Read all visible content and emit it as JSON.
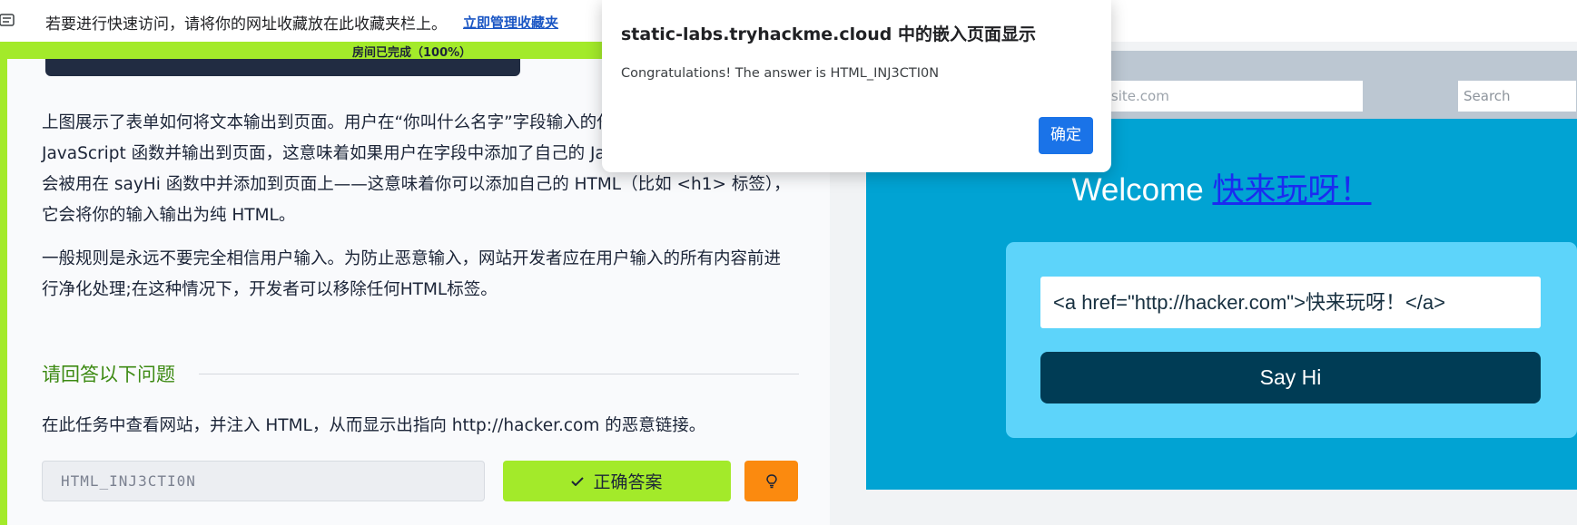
{
  "bookmark_bar": {
    "message": "若要进行快速访问，请将你的网址收藏放在此收藏夹栏上。",
    "manage_link": "立即管理收藏夹"
  },
  "progress": {
    "label": "房间已完成（100%）",
    "percent": 100
  },
  "task": {
    "paragraphs": [
      "上图展示了表单如何将文本输出到页面。用户在“你叫什么名字”字段输入的任何内容都会被传递给 JavaScript 函数并输出到页面，这意味着如果用户在字段中添加了自己的 JavaScript 或 HTML，它会被用在 sayHi 函数中并添加到页面上——这意味着你可以添加自己的 HTML（比如 <h1> 标签），它会将你的输入输出为纯 HTML。",
      "一般规则是永远不要完全相信用户输入。为防止恶意输入，网站开发者应在用户输入的所有内容前进行净化处理;在这种情况下，开发者可以移除任何HTML标签。"
    ],
    "question_header": "请回答以下问题",
    "question": "在此任务中查看网站，并注入 HTML，从而显示出指向 http://hacker.com 的恶意链接。",
    "answer_value": "HTML_INJ3CTI0N",
    "correct_button": "正确答案",
    "hint_icon": "lightbulb-icon"
  },
  "site": {
    "url": "http://vulnerable-site.com",
    "search_placeholder": "Search",
    "welcome_prefix": "Welcome ",
    "welcome_link": "快来玩呀！",
    "input_value": "<a href=\"http://hacker.com\">快来玩呀！</a>",
    "say_hi_button": "Say Hi"
  },
  "dialog": {
    "title": "static-labs.tryhackme.cloud 中的嵌入页面显示",
    "message": "Congratulations! The answer is HTML_INJ3CTI0N",
    "ok_button": "确定"
  },
  "colors": {
    "accent_green": "#a3ea2a",
    "site_blue": "#01a3d3",
    "button_dark": "#003c55",
    "hint_orange": "#fb8a0f",
    "dialog_blue": "#1a73e8"
  }
}
